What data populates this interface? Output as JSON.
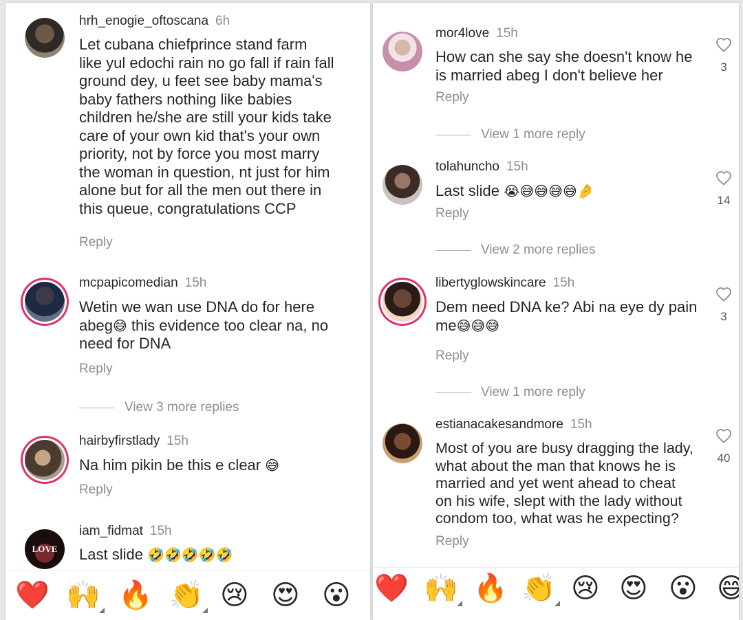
{
  "left": {
    "comments": [
      {
        "username": "hrh_enogie_oftoscana",
        "time": "6h",
        "text": "Let cubana chiefprince stand farm\nlike yul edochi rain no go fall if rain fall\nground dey, u feet see baby mama's\nbaby fathers nothing like babies\nchildren he/she are still your kids take\ncare of your own kid that's your own\npriority, not by force you most marry\nthe woman in question, nt just for him\nalone but for all the men out there in\nthis queue, congratulations CCP",
        "reply": "Reply"
      },
      {
        "username": "mcpapicomedian",
        "time": "15h",
        "text_a": "Wetin we wan use DNA do for here\nabeg",
        "emoji_a": "😅",
        "text_b": " this evidence too clear na, no\nneed for DNA",
        "reply": "Reply",
        "view_more": "View 3 more replies"
      },
      {
        "username": "hairbyfirstlady",
        "time": "15h",
        "text": "Na him pikin be this e clear ",
        "emoji": "😅",
        "reply": "Reply"
      },
      {
        "username": "iam_fidmat",
        "time": "15h",
        "text": "Last slide ",
        "emoji": "🤣🤣🤣🤣🤣",
        "avatar_text": "LOVE"
      }
    ],
    "emojis": [
      "❤️",
      "🙌",
      "🔥",
      "👏",
      "😢",
      "😍",
      "😮"
    ]
  },
  "right": {
    "comments": [
      {
        "username": "mor4love",
        "time": "15h",
        "text": "How can she say she doesn't know he\nis married abeg I don't believe her",
        "reply": "Reply",
        "likes": "3",
        "view_more": "View 1 more reply"
      },
      {
        "username": "tolahuncho",
        "time": "15h",
        "text": "Last slide ",
        "emoji": "😭😅😅😅😅🤌",
        "reply": "Reply",
        "likes": "14",
        "view_more": "View 2 more replies"
      },
      {
        "username": "libertyglowskincare",
        "time": "15h",
        "text": "Dem need DNA ke? Abi na eye dy pain\nme",
        "emoji": "😅😅😅",
        "reply": "Reply",
        "likes": "3",
        "view_more": "View 1 more reply"
      },
      {
        "username": "estianacakesandmore",
        "time": "15h",
        "text": "Most of you are busy dragging the lady,\nwhat about the man that knows he is\nmarried and yet went ahead to cheat\non his wife,  slept with the lady without\ncondom too, what was he expecting?",
        "reply": "Reply",
        "likes": "40"
      }
    ],
    "emojis": [
      "❤️",
      "🙌",
      "🔥",
      "👏",
      "😢",
      "😍",
      "😮",
      "😅"
    ]
  },
  "colors": {
    "story_ring": "#e1306c",
    "muted": "#8e8e8e",
    "text": "#262626"
  }
}
